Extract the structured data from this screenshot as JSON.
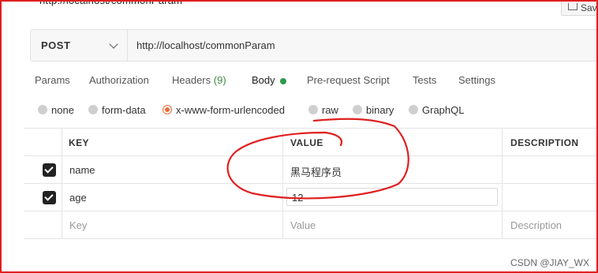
{
  "header": {
    "url_title": "http://localhost/commonParam",
    "save_label": "Save"
  },
  "request": {
    "method": "POST",
    "url": "http://localhost/commonParam"
  },
  "tabs": [
    {
      "label": "Params"
    },
    {
      "label": "Authorization"
    },
    {
      "label": "Headers",
      "count": "(9)"
    },
    {
      "label": "Body"
    },
    {
      "label": "Pre-request Script"
    },
    {
      "label": "Tests"
    },
    {
      "label": "Settings"
    }
  ],
  "body_types": [
    {
      "label": "none"
    },
    {
      "label": "form-data"
    },
    {
      "label": "x-www-form-urlencoded"
    },
    {
      "label": "raw"
    },
    {
      "label": "binary"
    },
    {
      "label": "GraphQL"
    }
  ],
  "table": {
    "headers": {
      "key": "KEY",
      "value": "VALUE",
      "description": "DESCRIPTION"
    },
    "rows": [
      {
        "key": "name",
        "value": "黑马程序员"
      },
      {
        "key": "age",
        "value": "12"
      }
    ],
    "placeholders": {
      "key": "Key",
      "value": "Value",
      "description": "Description"
    }
  },
  "watermark": "CSDN @JIAY_WX",
  "colors": {
    "annotation_red": "#e02020",
    "radio_selected": "#f26b3a",
    "body_dot": "#2e9a4c"
  }
}
